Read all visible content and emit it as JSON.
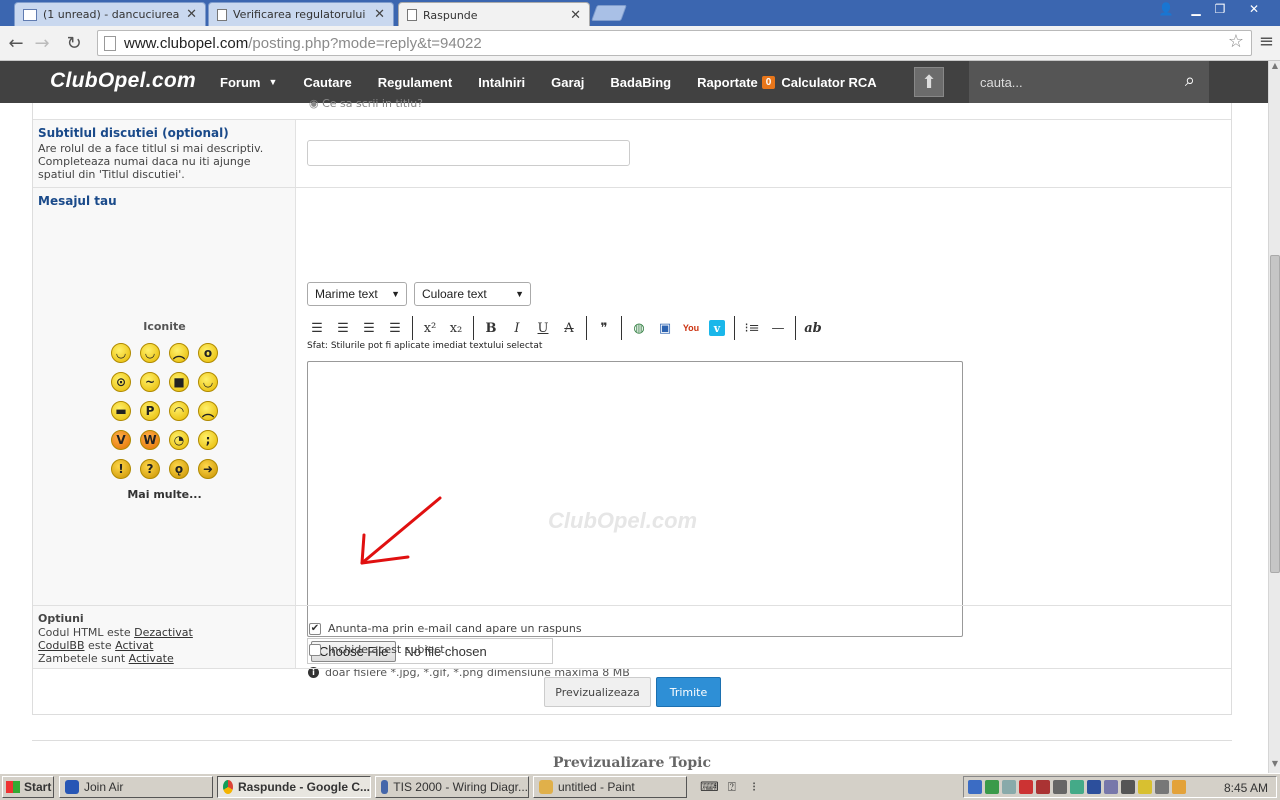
{
  "browser": {
    "tabs": [
      {
        "label": "(1 unread) - dancuciureanu - ...",
        "active": false
      },
      {
        "label": "Verificarea regulatorului de te...",
        "active": false
      },
      {
        "label": "Raspunde",
        "active": true
      }
    ],
    "url_host": "www.clubopel.com",
    "url_path": "/posting.php?mode=reply&t=94022"
  },
  "site": {
    "logo": "ClubOpel.com",
    "nav": [
      "Forum",
      "Cautare",
      "Regulament",
      "Intalniri",
      "Garaj",
      "BadaBing",
      "Raportate"
    ],
    "reports_count": "0",
    "nav_extra": "Calculator RCA",
    "search_placeholder": "cauta..."
  },
  "form": {
    "title_hint": "Ce sa scrii in titlu?",
    "subtitle": {
      "label": "Subtitlul discutiei (optional)",
      "description": "Are rolul de a face titlul si mai descriptiv. Completeaza numai daca nu iti ajunge spatiul din 'Titlul discutiei'.",
      "value": ""
    },
    "message": {
      "label": "Mesajul tau",
      "emoticons_title": "Iconite",
      "more_emoticons": "Mai multe...",
      "size_select": "Marime text",
      "color_select": "Culoare text",
      "tip": "Sfat: Stilurile pot fi aplicate imediat textului selectat",
      "editor_value": "",
      "watermark": "ClubOpel.com",
      "choose_file": "Choose File",
      "no_file": "No file chosen",
      "file_note": "doar fisiere *.jpg, *.gif, *.png dimensiune maxima 8 MB"
    },
    "options": {
      "label": "Optiuni",
      "html_prefix": "Codul HTML este",
      "html_state": "Dezactivat",
      "bbcode_name": "CodulBB",
      "bbcode_mid": "este",
      "bbcode_state": "Activat",
      "smilies_prefix": "Zambetele sunt",
      "smilies_state": "Activate",
      "notify": "Anunta-ma prin e-mail cand apare un raspuns",
      "notify_checked": true,
      "lock": "Inchide acest subiect",
      "lock_checked": false
    },
    "buttons": {
      "preview": "Previzualizeaza",
      "submit": "Trimite"
    },
    "preview_heading": "Previzualizare Topic"
  },
  "taskbar": {
    "start": "Start",
    "tasks": [
      "Join Air",
      "Raspunde - Google C...",
      "TIS 2000 - Wiring Diagr...",
      "untitled - Paint"
    ],
    "active_task": 1,
    "clock": "8:45 AM"
  },
  "colors": {
    "nav_bg": "#414141",
    "accent_blue": "#2e8fd6",
    "badge": "#e8761a",
    "label_blue": "#1a4a8a"
  }
}
